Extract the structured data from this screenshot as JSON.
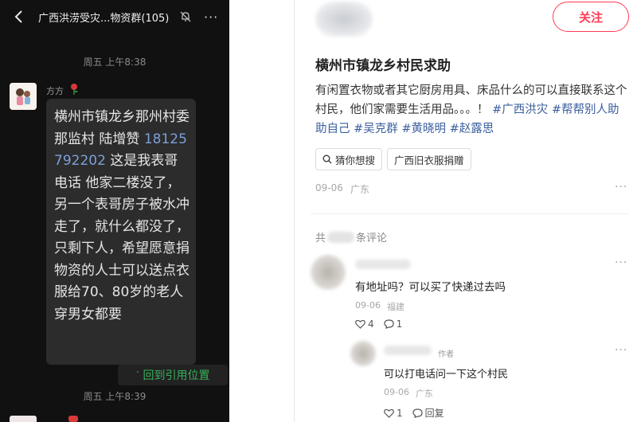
{
  "chat": {
    "title": "广西洪涝受灾...物资群(105)",
    "more": "···",
    "time_top": "周五 上午8:38",
    "sender": "方方",
    "message_before_phone": "横州市镇龙乡那州村委那监村 陆增赞",
    "phone": "18125792202",
    "message_after_phone": "这是我表哥电话 他家二楼没了，另一个表哥房子被水冲走了，就什么都没了，只剩下人，希望愿意捐物资的人士可以送点衣服给70、80岁的老人穿男女都要",
    "quote_button": "回到引用位置",
    "time_bottom": "周五 上午8:39"
  },
  "post": {
    "follow_button": "关注",
    "title": "横州市镇龙乡村民求助",
    "body": "有闲置衣物或者其它厨房用具、床品什么的可以直接联系这个村民，他们家需要生活用品。。。！",
    "tags": [
      "#广西洪灾",
      "#帮帮别人助助自己",
      "#吴克群",
      "#黄晓明",
      "#赵露思"
    ],
    "chips": [
      "猜你想搜",
      "广西旧衣服捐赠"
    ],
    "date": "09-06",
    "location": "广东",
    "more": "···"
  },
  "comments": {
    "header_prefix": "共",
    "header_suffix": "条评论",
    "items": [
      {
        "text": "有地址吗？可以买了快递过去吗",
        "date": "09-06",
        "location": "福建",
        "likes": "4",
        "replies": "1",
        "more": "···"
      },
      {
        "author_tag": "作者",
        "text": "可以打电话问一下这个村民",
        "date": "09-06",
        "location": "广东",
        "likes": "1",
        "reply_label": "回复",
        "more": "···"
      }
    ]
  },
  "colors": {
    "accent": "#ff3b55",
    "link": "#3a5f9e",
    "chat_bg": "#111111",
    "bubble_bg": "#2c2c2c",
    "quote_green": "#36b15a"
  }
}
